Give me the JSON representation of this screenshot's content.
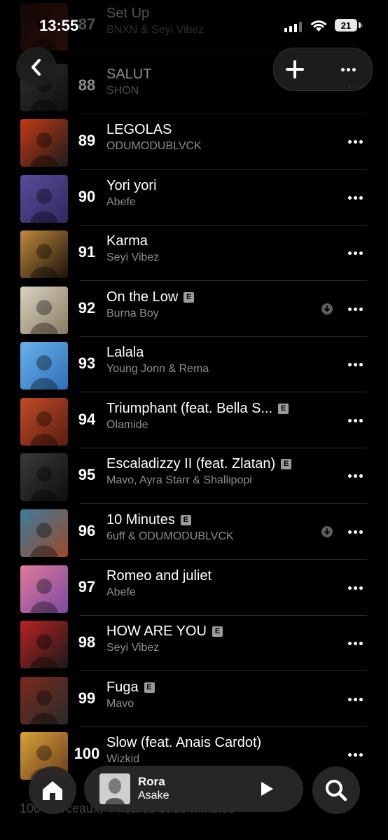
{
  "status_bar": {
    "time": "13:55",
    "battery": "21"
  },
  "tracks": [
    {
      "rank": "87",
      "title": "Set Up",
      "artist": "BNXN & Seyi Vibez",
      "explicit": false,
      "downloaded": false,
      "art_colors": [
        "#3a1a14",
        "#7a2a1a"
      ]
    },
    {
      "rank": "88",
      "title": "SALUT",
      "artist": "SHON",
      "explicit": false,
      "downloaded": false,
      "art_colors": [
        "#5a5a5a",
        "#1a1a1a"
      ]
    },
    {
      "rank": "89",
      "title": "LEGOLAS",
      "artist": "ODUMODUBLVCK",
      "explicit": false,
      "downloaded": false,
      "art_colors": [
        "#c53a14",
        "#1b1b1b"
      ]
    },
    {
      "rank": "90",
      "title": "Yori yori",
      "artist": "Abefe",
      "explicit": false,
      "downloaded": false,
      "art_colors": [
        "#5b4a9a",
        "#2e2a5e"
      ]
    },
    {
      "rank": "91",
      "title": "Karma",
      "artist": "Seyi Vibez",
      "explicit": false,
      "downloaded": false,
      "art_colors": [
        "#c08a3e",
        "#1a120a"
      ]
    },
    {
      "rank": "92",
      "title": "On the Low",
      "artist": "Burna Boy",
      "explicit": true,
      "downloaded": true,
      "art_colors": [
        "#d8d2c0",
        "#8a7c62"
      ]
    },
    {
      "rank": "93",
      "title": "Lalala",
      "artist": "Young Jonn & Rema",
      "explicit": false,
      "downloaded": false,
      "art_colors": [
        "#6ab2ea",
        "#2d6fb8"
      ]
    },
    {
      "rank": "94",
      "title": "Triumphant (feat. Bella S...",
      "artist": "Olamide",
      "explicit": true,
      "downloaded": false,
      "art_colors": [
        "#c24a28",
        "#5a1e10"
      ]
    },
    {
      "rank": "95",
      "title": "Escaladizzy II (feat. Zlatan)",
      "artist": "Mavo, Ayra Starr & Shallipopi",
      "explicit": true,
      "downloaded": false,
      "art_colors": [
        "#3a3a3a",
        "#0e0e0e"
      ]
    },
    {
      "rank": "96",
      "title": "10 Minutes",
      "artist": "6uff & ODUMODUBLVCK",
      "explicit": true,
      "downloaded": true,
      "art_colors": [
        "#3c7c9a",
        "#9a4a2a"
      ]
    },
    {
      "rank": "97",
      "title": "Romeo and juliet",
      "artist": "Abefe",
      "explicit": false,
      "downloaded": false,
      "art_colors": [
        "#e07a9a",
        "#7a4aa2"
      ]
    },
    {
      "rank": "98",
      "title": "HOW ARE YOU",
      "artist": "Seyi Vibez",
      "explicit": true,
      "downloaded": false,
      "art_colors": [
        "#b82222",
        "#1a1a1a"
      ]
    },
    {
      "rank": "99",
      "title": "Fuga",
      "artist": "Mavo",
      "explicit": true,
      "downloaded": false,
      "art_colors": [
        "#7a2a1e",
        "#2a2a2a"
      ]
    },
    {
      "rank": "100",
      "title": "Slow (feat. Anais Cardot)",
      "artist": "Wizkid",
      "explicit": false,
      "downloaded": false,
      "art_colors": [
        "#d9a23a",
        "#6a3a1a"
      ]
    }
  ],
  "footer": {
    "summary": "100 morceaux, 4 heures et 53 minutes"
  },
  "now_playing": {
    "title": "Rora",
    "artist": "Asake"
  },
  "icons": {
    "back": "chevron-left-icon",
    "add": "plus-icon",
    "more": "ellipsis-icon",
    "download": "download-icon",
    "home": "home-icon",
    "play": "play-icon",
    "search": "search-icon"
  },
  "colors": {
    "background": "#000000",
    "secondary_text": "#8d8d8d",
    "separator": "#2a2a2a"
  }
}
